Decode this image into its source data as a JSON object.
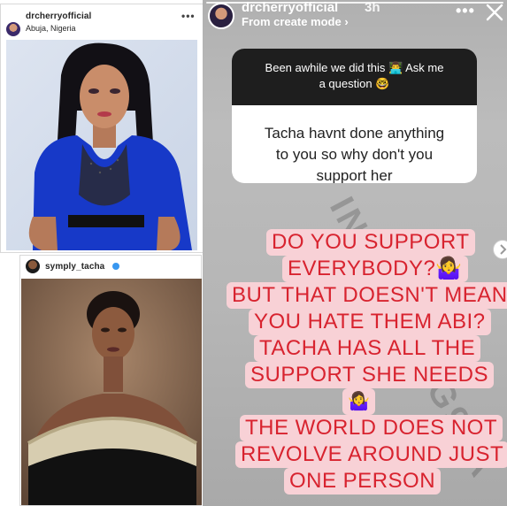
{
  "post1": {
    "username": "drcherryofficial",
    "location": "Abuja, Nigeria",
    "more": "•••"
  },
  "post2": {
    "username": "symply_tacha",
    "more": "•••"
  },
  "story": {
    "username": "drcherryofficial",
    "time": "3h",
    "source": "From create mode ›",
    "more": "•••",
    "question_prompt_line1": "Been awhile we did this 👨‍💻 Ask me",
    "question_prompt_line2": "a question 🤓",
    "question_text": [
      "Tacha havnt done anything",
      "to you so why don't you",
      "support her"
    ],
    "reply_lines": [
      "DO YOU SUPPORT",
      "EVERYBODY?🤷‍♀️",
      "BUT THAT DOESN'T MEAN",
      "YOU HATE THEM ABI?",
      "TACHA HAS ALL THE",
      "SUPPORT SHE NEEDS",
      "🤷‍♀️",
      "THE WORLD DOES NOT",
      "REVOLVE AROUND JUST",
      "ONE PERSON"
    ]
  },
  "colors": {
    "reply_bg": "#f8d1d6",
    "reply_text": "#d8232f",
    "question_header": "#1e1e1e",
    "verified": "#3897f0"
  }
}
